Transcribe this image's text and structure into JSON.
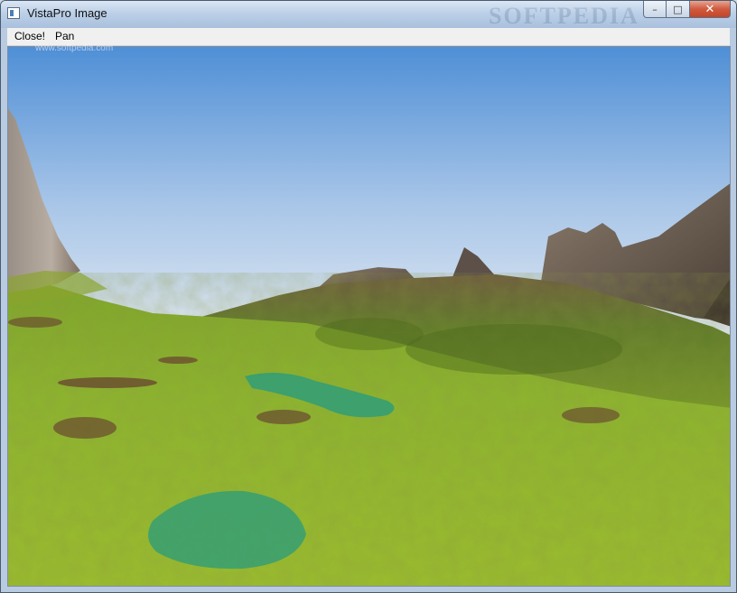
{
  "window": {
    "title": "VistaPro Image",
    "watermark": "SOFTPEDIA",
    "watermark_sub": "www.softpedia.com"
  },
  "caption_buttons": {
    "minimize": "–",
    "maximize": "□",
    "close": "✕"
  },
  "menu": {
    "items": [
      "Close!",
      "Pan"
    ]
  },
  "scene": {
    "sky_top": "#4f8fd6",
    "sky_bottom": "#dfe8f2",
    "grass": "#8ab02c",
    "rock": "#6e5f52",
    "water": "#2f9e78"
  }
}
